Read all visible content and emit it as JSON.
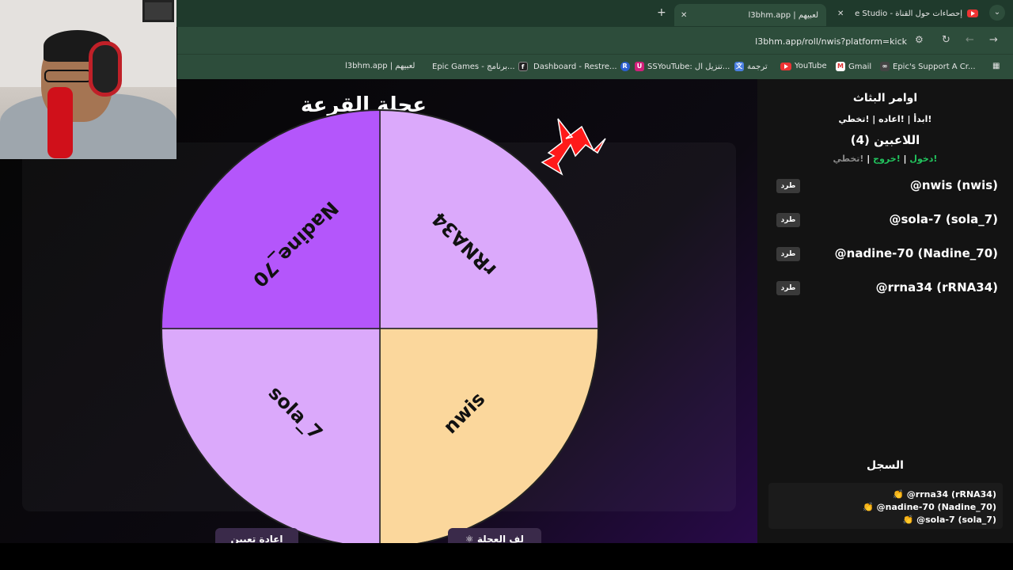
{
  "browser": {
    "tabs": [
      {
        "label": "إحصاءات حول القناة - YouTube Studio"
      },
      {
        "label": "l3bhm.app | لعبيهم"
      }
    ],
    "url": "l3bhm.app/roll/nwis?platform=kick",
    "bookmarks": [
      {
        "label": "Epic's Support A Cr..."
      },
      {
        "label": "Gmail"
      },
      {
        "label": "YouTube"
      },
      {
        "label": "ترجمة"
      },
      {
        "label": "SSYouTube: تنزيل ال..."
      },
      {
        "label": "Dashboard - Restre..."
      },
      {
        "label": "Epic Games - برنامج..."
      },
      {
        "label": "l3bhm.app | لعبيهم"
      }
    ]
  },
  "wheel": {
    "title": "عجلة القرعة",
    "segments": [
      {
        "label": "rRNA34",
        "color": "#dba9fb"
      },
      {
        "label": "nwis",
        "color": "#fbd79c"
      },
      {
        "label": "sola_7",
        "color": "#dba9fb"
      },
      {
        "label": "Nadine_70",
        "color": "#b456fb"
      }
    ],
    "buttons": {
      "reset": "اعادة تعيين",
      "spin": "⚛ لف العجلة"
    }
  },
  "panel": {
    "commands_title": "اوامر البثاث",
    "commands": "!ابدأ | !اعاده | !تخطي",
    "players_title": "اللاعبين (4)",
    "player_cmds": {
      "join": "!دخول",
      "leave": "!خروج",
      "skip": "!تخطي"
    },
    "kick_label": "طرد",
    "players": [
      {
        "name": "@nwis (nwis)"
      },
      {
        "name": "@sola-7 (sola_7)"
      },
      {
        "name": "@nadine-70 (Nadine_70)"
      },
      {
        "name": "@rrna34 (rRNA34)"
      }
    ],
    "log_title": "السجل",
    "log": [
      {
        "text": "👏 @rrna34 (rRNA34)"
      },
      {
        "text": "👏 @nadine-70 (Nadine_70)"
      },
      {
        "text": "👏 @sola-7 (sola_7)"
      }
    ]
  },
  "colors": {
    "accent_green": "#22c55e",
    "panel_bg": "#131313"
  }
}
